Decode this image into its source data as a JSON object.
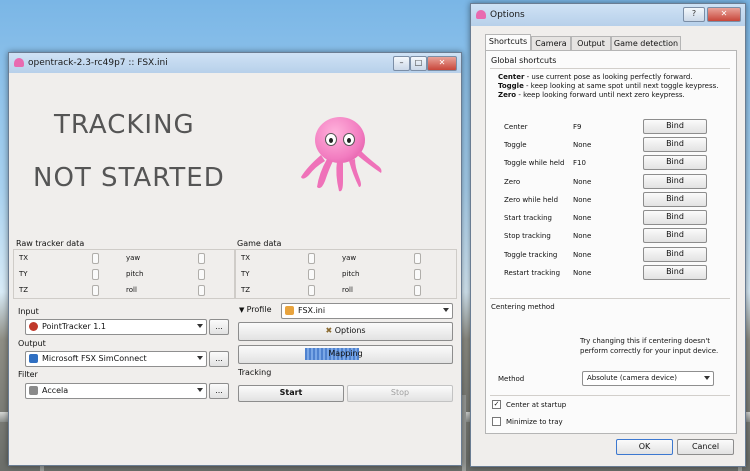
{
  "main_window": {
    "title": "opentrack-2.3-rc49p7 :: FSX.ini",
    "status_line1": "TRACKING",
    "status_line2": "NOT STARTED",
    "raw_tracker": {
      "title": "Raw tracker data",
      "left_labels": [
        "TX",
        "TY",
        "TZ"
      ],
      "right_labels": [
        "yaw",
        "pitch",
        "roll"
      ]
    },
    "game_data": {
      "title": "Game data",
      "left_labels": [
        "TX",
        "TY",
        "TZ"
      ],
      "right_labels": [
        "yaw",
        "pitch",
        "roll"
      ]
    },
    "input": {
      "label": "Input",
      "value": "PointTracker 1.1",
      "more": "..."
    },
    "output": {
      "label": "Output",
      "value": "Microsoft FSX SimConnect",
      "more": "..."
    },
    "filter": {
      "label": "Filter",
      "value": "Accela",
      "more": "..."
    },
    "profile": {
      "label": "Profile",
      "value": "FSX.ini"
    },
    "options_button": "Options",
    "mapping_button": "Mapping",
    "tracking_label": "Tracking",
    "start_button": "Start",
    "stop_button": "Stop"
  },
  "options_window": {
    "title": "Options",
    "help": "?",
    "tabs": [
      "Shortcuts",
      "Camera",
      "Output",
      "Game detection"
    ],
    "global_shortcuts": "Global shortcuts",
    "desc": [
      {
        "bold": "Center",
        "text": " - use current pose as looking perfectly forward."
      },
      {
        "bold": "Toggle",
        "text": " - keep looking at same spot until next toggle keypress."
      },
      {
        "bold": "Zero",
        "text": " - keep looking forward until next zero keypress."
      }
    ],
    "bind_label": "Bind",
    "shortcuts": [
      {
        "name": "Center",
        "key": "F9"
      },
      {
        "name": "Toggle",
        "key": "None"
      },
      {
        "name": "Toggle while held",
        "key": "F10"
      },
      {
        "name": "Zero",
        "key": "None"
      },
      {
        "name": "Zero while held",
        "key": "None"
      },
      {
        "name": "Start tracking",
        "key": "None"
      },
      {
        "name": "Stop tracking",
        "key": "None"
      },
      {
        "name": "Toggle tracking",
        "key": "None"
      },
      {
        "name": "Restart tracking",
        "key": "None"
      }
    ],
    "centering_title": "Centering method",
    "centering_hint_1": "Try changing this if centering doesn't",
    "centering_hint_2": "perform correctly for your input device.",
    "method_label": "Method",
    "method_value": "Absolute (camera device)",
    "center_at_startup": "Center at startup",
    "center_at_startup_checked": true,
    "minimize_to_tray": "Minimize to tray",
    "minimize_to_tray_checked": false,
    "ok": "OK",
    "cancel": "Cancel"
  },
  "colors": {
    "accent": "#3c78d0",
    "octopus": "#f27cc0",
    "title_bar": "#b7d0ea"
  }
}
